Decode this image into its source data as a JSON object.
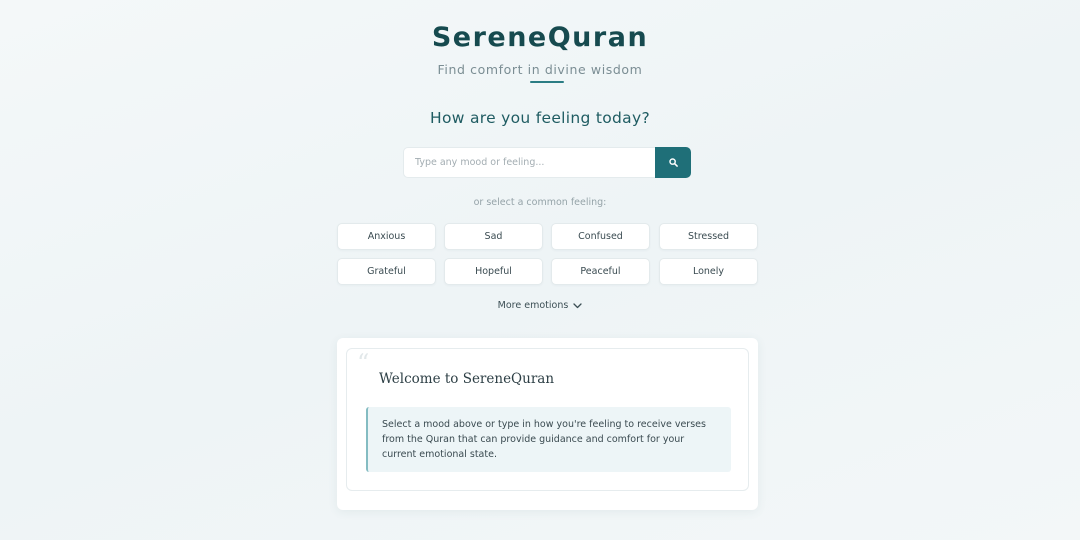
{
  "header": {
    "app_title": "SereneQuran",
    "tagline": "Find comfort in divine wisdom"
  },
  "prompt": {
    "question": "How are you feeling today?"
  },
  "search": {
    "placeholder": "Type any mood or feeling...",
    "value": "",
    "button_icon": "search-icon"
  },
  "moods": {
    "hint": "or select a common feeling:",
    "chips": [
      "Anxious",
      "Sad",
      "Confused",
      "Stressed",
      "Grateful",
      "Hopeful",
      "Peaceful",
      "Lonely"
    ],
    "more_label": "More emotions",
    "more_icon": "chevron-down-icon"
  },
  "welcome": {
    "quote_icon": "quote-icon",
    "title": "Welcome to SereneQuran",
    "message": "Select a mood above or type in how you're feeling to receive verses from the Quran that can provide guidance and comfort for your current emotional state."
  },
  "colors": {
    "brand": "#164a4f",
    "accent": "#1f6f78",
    "background": "#f1f6f7",
    "message_bg": "#edf5f7"
  }
}
